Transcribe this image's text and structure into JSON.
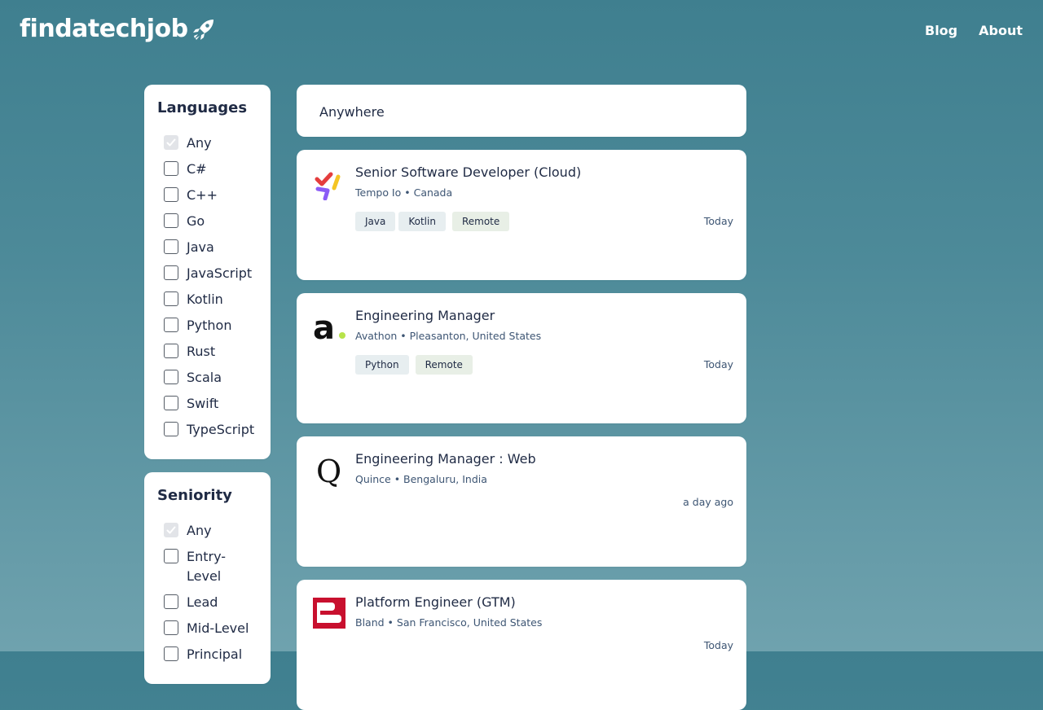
{
  "header": {
    "logo_text": "findatechjob",
    "nav": [
      {
        "label": "Blog"
      },
      {
        "label": "About"
      }
    ]
  },
  "filters": {
    "languages": {
      "title": "Languages",
      "options": [
        {
          "label": "Any",
          "checked": true
        },
        {
          "label": "C#",
          "checked": false
        },
        {
          "label": "C++",
          "checked": false
        },
        {
          "label": "Go",
          "checked": false
        },
        {
          "label": "Java",
          "checked": false
        },
        {
          "label": "JavaScript",
          "checked": false
        },
        {
          "label": "Kotlin",
          "checked": false
        },
        {
          "label": "Python",
          "checked": false
        },
        {
          "label": "Rust",
          "checked": false
        },
        {
          "label": "Scala",
          "checked": false
        },
        {
          "label": "Swift",
          "checked": false
        },
        {
          "label": "TypeScript",
          "checked": false
        }
      ]
    },
    "seniority": {
      "title": "Seniority",
      "options": [
        {
          "label": "Any",
          "checked": true
        },
        {
          "label": "Entry-Level",
          "checked": false
        },
        {
          "label": "Lead",
          "checked": false
        },
        {
          "label": "Mid-Level",
          "checked": false
        },
        {
          "label": "Principal",
          "checked": false
        }
      ]
    }
  },
  "search": {
    "placeholder": "Anywhere"
  },
  "jobs": [
    {
      "title": "Senior Software Developer (Cloud)",
      "meta": "Tempo Io • Canada",
      "tags": [
        "Java",
        "Kotlin"
      ],
      "remote_tag": "Remote",
      "date": "Today",
      "logo": "tempo-logo"
    },
    {
      "title": "Engineering Manager",
      "meta": "Avathon • Pleasanton, United States",
      "tags": [
        "Python"
      ],
      "remote_tag": "Remote",
      "date": "Today",
      "logo": "avathon-logo"
    },
    {
      "title": "Engineering Manager : Web",
      "meta": "Quince • Bengaluru, India",
      "tags": [],
      "remote_tag": "",
      "date": "a day ago",
      "logo": "quince-logo"
    },
    {
      "title": "Platform Engineer (GTM)",
      "meta": "Bland • San Francisco, United States",
      "tags": [],
      "remote_tag": "",
      "date": "Today",
      "logo": "bland-logo"
    }
  ],
  "colors": {
    "background_top": "#3f7f8f",
    "background_bottom": "#6fa2ae",
    "text": "#1f2a44",
    "meta_text": "#3d5573",
    "tag_bg": "#e7eef0",
    "remote_tag_bg": "#e8efe6",
    "bland_red": "#c8102e",
    "avathon_green": "#b7e34a"
  }
}
